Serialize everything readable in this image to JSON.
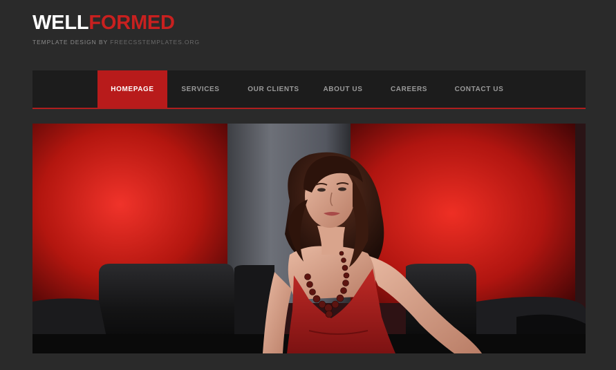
{
  "logo": {
    "part1": "WELL",
    "part2": "FORMED"
  },
  "tagline": {
    "prefix": "TEMPLATE DESIGN BY ",
    "link": "FREECSSTEMPLATES.ORG"
  },
  "nav": {
    "items": [
      {
        "label": "HOMEPAGE"
      },
      {
        "label": "SERVICES"
      },
      {
        "label": "OUR CLIENTS"
      },
      {
        "label": "ABOUT US"
      },
      {
        "label": "CAREERS"
      },
      {
        "label": "CONTACT US"
      }
    ],
    "active_index": 0
  },
  "colors": {
    "background": "#2a2a2a",
    "accent": "#b81b1b",
    "nav_bg": "#1c1c1c"
  }
}
